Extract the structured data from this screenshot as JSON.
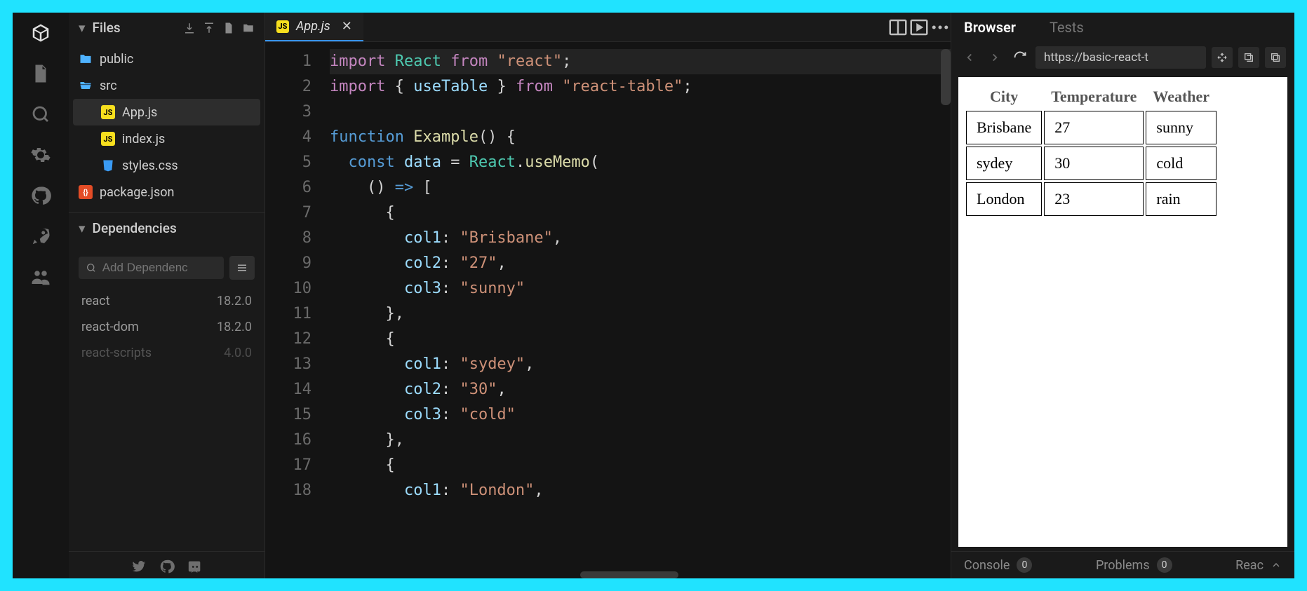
{
  "activity": {
    "items": [
      "box",
      "file",
      "search",
      "settings",
      "github",
      "rocket",
      "users"
    ]
  },
  "sidebar": {
    "files_header": "Files",
    "tree": [
      {
        "kind": "folder",
        "name": "public",
        "depth": 0,
        "open": false
      },
      {
        "kind": "folder",
        "name": "src",
        "depth": 0,
        "open": true
      },
      {
        "kind": "file",
        "name": "App.js",
        "depth": 1,
        "ftype": "js",
        "selected": true
      },
      {
        "kind": "file",
        "name": "index.js",
        "depth": 1,
        "ftype": "js"
      },
      {
        "kind": "file",
        "name": "styles.css",
        "depth": 1,
        "ftype": "css"
      },
      {
        "kind": "file",
        "name": "package.json",
        "depth": 0,
        "ftype": "json"
      }
    ],
    "deps_header": "Dependencies",
    "deps_search_placeholder": "Add Dependenc",
    "deps": [
      {
        "name": "react",
        "version": "18.2.0"
      },
      {
        "name": "react-dom",
        "version": "18.2.0"
      },
      {
        "name": "react-scripts",
        "version": "4.0.0",
        "dim": true
      }
    ]
  },
  "editor": {
    "tab_file": "App.js",
    "line_start": 1,
    "line_count": 18,
    "code_lines": [
      [
        [
          "kw",
          "import"
        ],
        [
          "pun",
          " "
        ],
        [
          "cls",
          "React"
        ],
        [
          "pun",
          " "
        ],
        [
          "kw",
          "from"
        ],
        [
          "pun",
          " "
        ],
        [
          "str",
          "\"react\""
        ],
        [
          "pun",
          ";"
        ]
      ],
      [
        [
          "kw",
          "import"
        ],
        [
          "pun",
          " { "
        ],
        [
          "var",
          "useTable"
        ],
        [
          "pun",
          " } "
        ],
        [
          "kw",
          "from"
        ],
        [
          "pun",
          " "
        ],
        [
          "str",
          "\"react-table\""
        ],
        [
          "pun",
          ";"
        ]
      ],
      [],
      [
        [
          "kw2",
          "function"
        ],
        [
          "pun",
          " "
        ],
        [
          "fn",
          "Example"
        ],
        [
          "pun",
          "() {"
        ]
      ],
      [
        [
          "pun",
          "  "
        ],
        [
          "kw2",
          "const"
        ],
        [
          "pun",
          " "
        ],
        [
          "var",
          "data"
        ],
        [
          "pun",
          " = "
        ],
        [
          "cls",
          "React"
        ],
        [
          "pun",
          "."
        ],
        [
          "fn",
          "useMemo"
        ],
        [
          "pun",
          "("
        ]
      ],
      [
        [
          "pun",
          "    () "
        ],
        [
          "op",
          "=>"
        ],
        [
          "pun",
          " ["
        ]
      ],
      [
        [
          "pun",
          "      {"
        ]
      ],
      [
        [
          "pun",
          "        "
        ],
        [
          "var",
          "col1"
        ],
        [
          "pun",
          ": "
        ],
        [
          "str",
          "\"Brisbane\""
        ],
        [
          "pun",
          ","
        ]
      ],
      [
        [
          "pun",
          "        "
        ],
        [
          "var",
          "col2"
        ],
        [
          "pun",
          ": "
        ],
        [
          "str",
          "\"27\""
        ],
        [
          "pun",
          ","
        ]
      ],
      [
        [
          "pun",
          "        "
        ],
        [
          "var",
          "col3"
        ],
        [
          "pun",
          ": "
        ],
        [
          "str",
          "\"sunny\""
        ]
      ],
      [
        [
          "pun",
          "      },"
        ]
      ],
      [
        [
          "pun",
          "      {"
        ]
      ],
      [
        [
          "pun",
          "        "
        ],
        [
          "var",
          "col1"
        ],
        [
          "pun",
          ": "
        ],
        [
          "str",
          "\"sydey\""
        ],
        [
          "pun",
          ","
        ]
      ],
      [
        [
          "pun",
          "        "
        ],
        [
          "var",
          "col2"
        ],
        [
          "pun",
          ": "
        ],
        [
          "str",
          "\"30\""
        ],
        [
          "pun",
          ","
        ]
      ],
      [
        [
          "pun",
          "        "
        ],
        [
          "var",
          "col3"
        ],
        [
          "pun",
          ": "
        ],
        [
          "str",
          "\"cold\""
        ]
      ],
      [
        [
          "pun",
          "      },"
        ]
      ],
      [
        [
          "pun",
          "      {"
        ]
      ],
      [
        [
          "pun",
          "        "
        ],
        [
          "var",
          "col1"
        ],
        [
          "pun",
          ": "
        ],
        [
          "str",
          "\"London\""
        ],
        [
          "pun",
          ","
        ]
      ]
    ]
  },
  "preview": {
    "tabs": {
      "browser": "Browser",
      "tests": "Tests"
    },
    "url": "https://basic-react-t",
    "table": {
      "headers": [
        "City",
        "Temperature",
        "Weather"
      ],
      "rows": [
        [
          "Brisbane",
          "27",
          "sunny"
        ],
        [
          "sydey",
          "30",
          "cold"
        ],
        [
          "London",
          "23",
          "rain"
        ]
      ]
    },
    "console": {
      "console_label": "Console",
      "console_badge": "0",
      "problems_label": "Problems",
      "problems_badge": "0",
      "right": "Reac"
    }
  }
}
